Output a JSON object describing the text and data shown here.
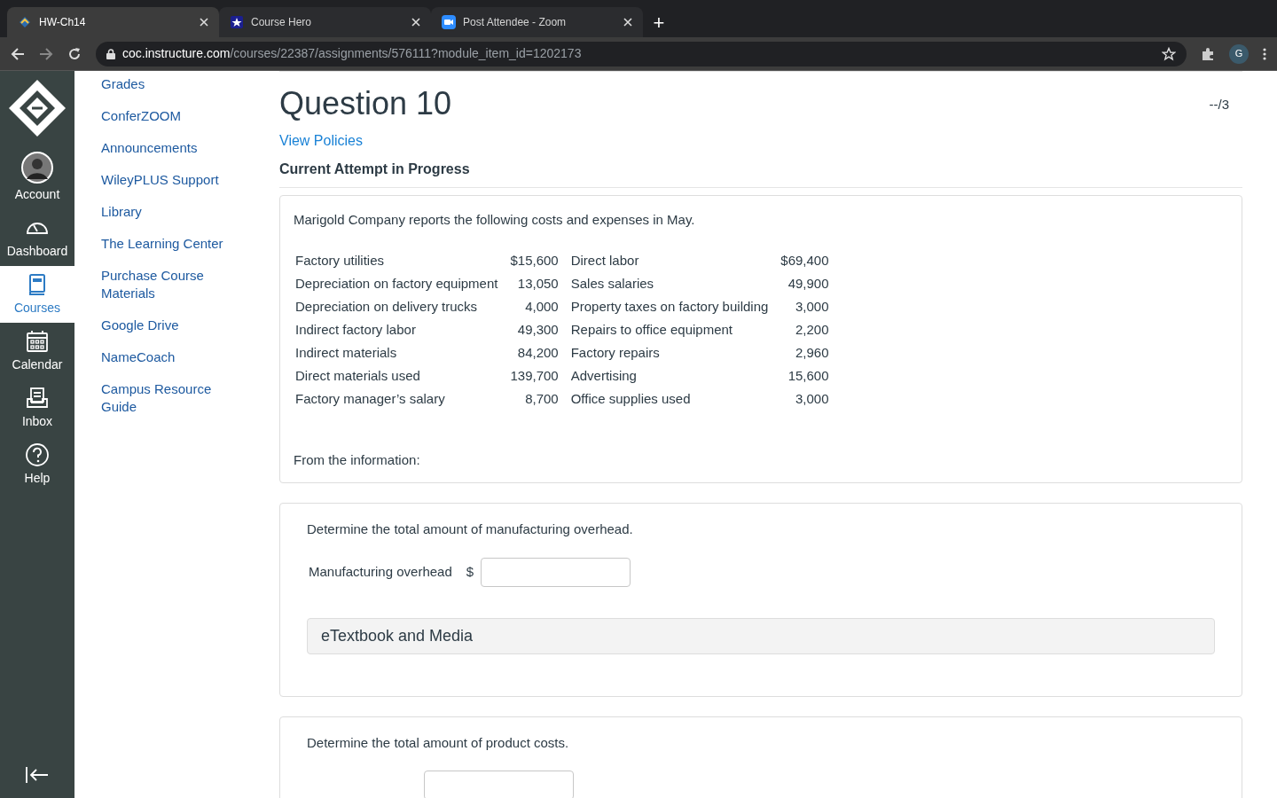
{
  "browser": {
    "tabs": [
      {
        "title": "HW-Ch14",
        "selected": true,
        "kind": "canvas"
      },
      {
        "title": "Course Hero",
        "selected": false,
        "kind": "star"
      },
      {
        "title": "Post Attendee - Zoom",
        "selected": false,
        "kind": "zoom"
      }
    ],
    "new_tab": "+",
    "url_host": "coc.instructure.com",
    "url_path": "/courses/22387/assignments/576111?module_item_id=1202173",
    "profile": "G"
  },
  "global_nav": [
    {
      "label": "Account",
      "kind": "avatar",
      "selected": false
    },
    {
      "label": "Dashboard",
      "kind": "dashboard",
      "selected": false
    },
    {
      "label": "Courses",
      "kind": "courses",
      "selected": true
    },
    {
      "label": "Calendar",
      "kind": "calendar",
      "selected": false
    },
    {
      "label": "Inbox",
      "kind": "inbox",
      "selected": false
    },
    {
      "label": "Help",
      "kind": "help",
      "selected": false
    }
  ],
  "course_nav": [
    "Grades",
    "ConferZOOM",
    "Announcements",
    "WileyPLUS Support",
    "Library",
    "The Learning Center",
    "Purchase Course Materials",
    "Google Drive",
    "NameCoach",
    "Campus Resource Guide"
  ],
  "question": {
    "title": "Question 10",
    "score": "--/3",
    "policies_link": "View Policies",
    "attempt": "Current Attempt in Progress",
    "intro": "Marigold Company reports the following costs and expenses in May.",
    "costs": [
      [
        "Factory utilities",
        "$15,600",
        "Direct labor",
        "$69,400"
      ],
      [
        "Depreciation on factory equipment",
        "13,050",
        "Sales salaries",
        "49,900"
      ],
      [
        "Depreciation on delivery trucks",
        "4,000",
        "Property taxes on factory building",
        "3,000"
      ],
      [
        "Indirect factory labor",
        "49,300",
        "Repairs to office equipment",
        "2,200"
      ],
      [
        "Indirect materials",
        "84,200",
        "Factory repairs",
        "2,960"
      ],
      [
        "Direct materials used",
        "139,700",
        "Advertising",
        "15,600"
      ],
      [
        "Factory manager’s salary",
        "8,700",
        "Office supplies used",
        "3,000"
      ]
    ],
    "outro": "From the information:"
  },
  "parts": [
    {
      "prompt": "Determine the total amount of manufacturing overhead.",
      "label": "Manufacturing overhead",
      "currency": "$",
      "media": "eTextbook and Media"
    },
    {
      "prompt": "Determine the total amount of product costs."
    }
  ]
}
